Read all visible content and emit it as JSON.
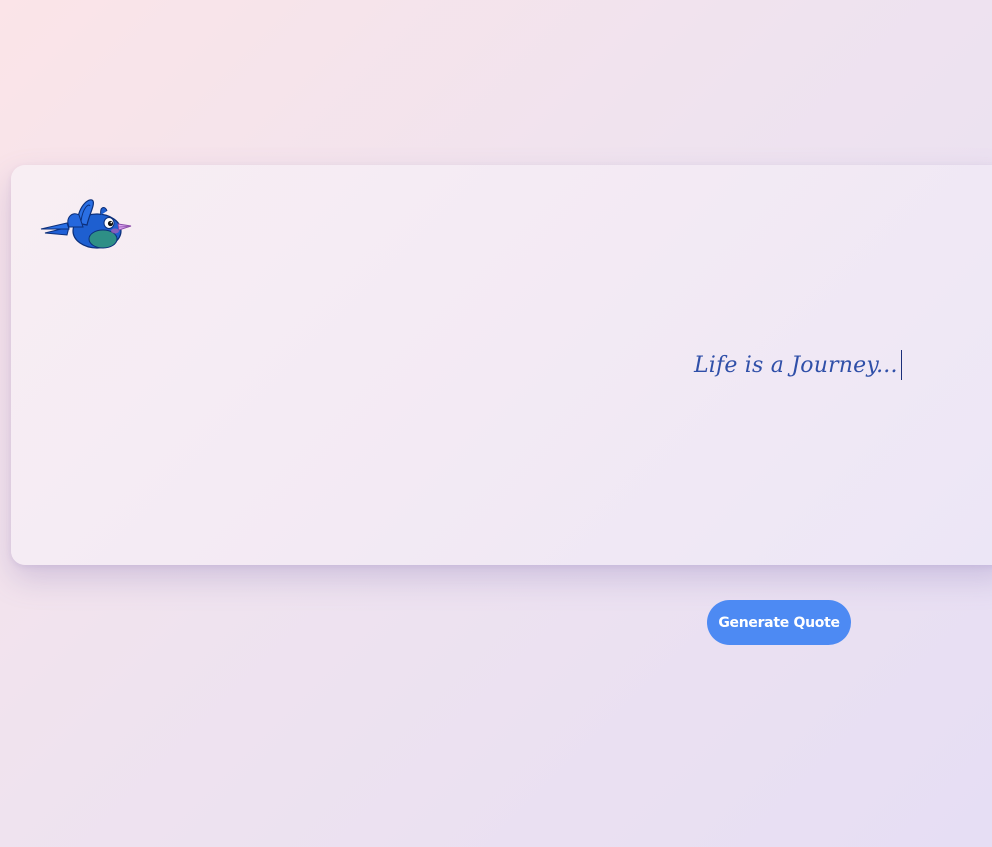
{
  "card": {
    "mascot_icon": "flying-blue-bird-icon",
    "quote_text": "Life is a Journey..."
  },
  "actions": {
    "generate_label": "Generate Quote"
  },
  "colors": {
    "button": "#4d8af3",
    "quote_text": "#2f4fa8",
    "bird_body": "#1e5fd0"
  }
}
